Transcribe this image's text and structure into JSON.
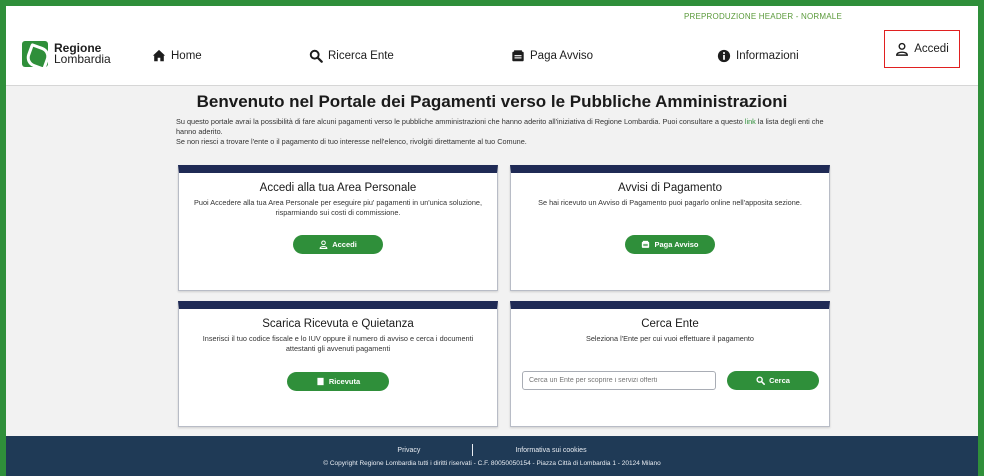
{
  "header": {
    "preprod_label": "PREPRODUZIONE HEADER - NORMALE",
    "logo_line1": "Regione",
    "logo_line2": "Lombardia",
    "nav": {
      "home": "Home",
      "ricerca_ente": "Ricerca Ente",
      "paga_avviso": "Paga Avviso",
      "informazioni": "Informazioni",
      "accedi": "Accedi"
    }
  },
  "main": {
    "title": "Benvenuto nel Portale dei Pagamenti verso le Pubbliche Amministrazioni",
    "intro_part1": "Su questo portale avrai la possibilità di fare alcuni pagamenti verso le pubbliche amministrazioni che hanno aderito all'iniziativa di Regione Lombardia. Puoi consultare a questo ",
    "intro_link": "link",
    "intro_part2": " la lista degli enti che hanno aderito.",
    "intro_line2": "Se non riesci a trovare l'ente o il pagamento di tuo interesse nell'elenco, rivolgiti direttamente al tuo Comune."
  },
  "cards": {
    "area_personale": {
      "title": "Accedi alla tua Area Personale",
      "desc": "Puoi Accedere alla tua Area Personale per eseguire piu' pagamenti in un'unica soluzione, risparmiando sui costi di commissione.",
      "button": "Accedi"
    },
    "avvisi": {
      "title": "Avvisi di Pagamento",
      "desc": "Se hai ricevuto un Avviso di Pagamento puoi pagarlo online nell'apposita sezione.",
      "button": "Paga Avviso"
    },
    "ricevuta": {
      "title": "Scarica Ricevuta e Quietanza",
      "desc": "Inserisci il tuo codice fiscale e lo IUV oppure il numero di avviso e cerca i documenti attestanti gli avvenuti pagamenti",
      "button": "Ricevuta"
    },
    "cerca_ente": {
      "title": "Cerca Ente",
      "desc": "Seleziona l'Ente per cui vuoi effettuare il pagamento",
      "placeholder": "Cerca un Ente per scoprire i servizi offerti",
      "button": "Cerca"
    }
  },
  "footer": {
    "privacy": "Privacy",
    "cookies": "Informativa sui cookies",
    "copyright": "© Copyright Regione Lombardia tutti i diritti riservati - C.F. 80050050154 - Piazza Città di Lombardia 1 - 20124 Milano"
  },
  "colors": {
    "brand_green": "#2f8f3a",
    "card_top": "#1f2a55",
    "footer_bg": "#1f3a56",
    "highlight_border": "#e02020"
  },
  "icons": [
    "home-icon",
    "search-icon",
    "receipt-icon",
    "info-icon",
    "user-icon",
    "document-icon"
  ]
}
